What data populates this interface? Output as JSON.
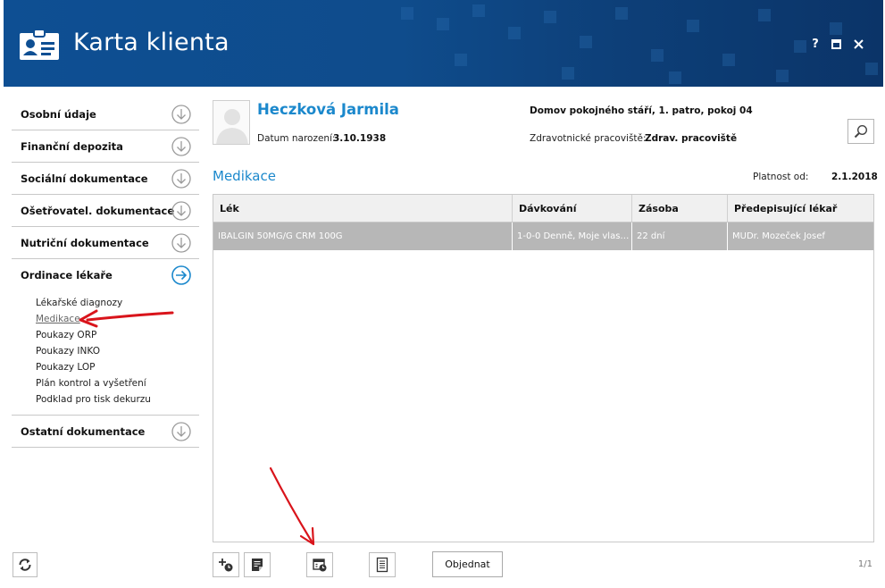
{
  "window": {
    "title": "Karta klienta",
    "help_label": "?",
    "maximize_label": "▣",
    "close_label": "✕"
  },
  "sidebar": {
    "sections": [
      {
        "label": "Osobní údaje"
      },
      {
        "label": "Finanční depozita"
      },
      {
        "label": "Sociální dokumentace"
      },
      {
        "label": "Ošetřovatel. dokumentace"
      },
      {
        "label": "Nutriční dokumentace"
      },
      {
        "label": "Ordinace lékaře",
        "expanded": true
      }
    ],
    "subitems": [
      {
        "label": "Lékařské diagnozy"
      },
      {
        "label": "Medikace",
        "active": true
      },
      {
        "label": "Poukazy ORP"
      },
      {
        "label": "Poukazy INKO"
      },
      {
        "label": "Poukazy LOP"
      },
      {
        "label": "Plán kontrol a vyšetření"
      },
      {
        "label": "Podklad pro tisk dekurzu"
      }
    ],
    "last_section": {
      "label": "Ostatní dokumentace"
    }
  },
  "patient": {
    "name": "Heczková Jarmila",
    "dob_label": "Datum narození:",
    "dob_value": "3.10.1938",
    "location": "Domov pokojného stáří, 1. patro, pokoj 04",
    "workplace_label": "Zdravotnické pracoviště:",
    "workplace_value": "Zdrav. pracoviště"
  },
  "section": {
    "title": "Medikace",
    "valid_label": "Platnost od:",
    "valid_value": "2.1.2018"
  },
  "table": {
    "columns": [
      "Lék",
      "Dávkování",
      "Zásoba",
      "Předepisující lékař"
    ],
    "rows": [
      [
        "IBALGIN 50MG/G CRM 100G",
        "1-0-0 Denně, Moje vlas…",
        "22 dní",
        "MUDr. Mozeček Josef"
      ]
    ]
  },
  "toolbar": {
    "order_label": "Objednat",
    "pager": "1/1"
  },
  "colors": {
    "header_bg": "#0e4f93",
    "accent": "#1b88cc",
    "selected_row": "#b7b7b7",
    "annotation_arrow": "#d9141b"
  }
}
